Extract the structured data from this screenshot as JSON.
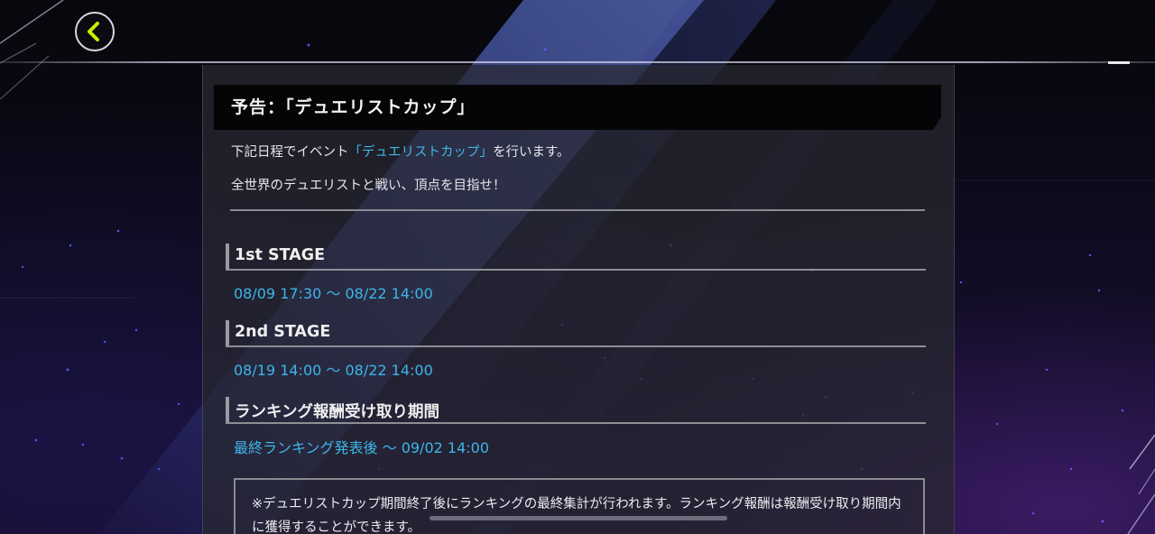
{
  "header": {
    "back_icon": "chevron-left-icon",
    "accent_color": "#c8f000"
  },
  "notice": {
    "title": "予告：「デュエリストカップ」",
    "intro_line1_prefix": "下記日程でイベント",
    "intro_line1_highlight": "「デュエリストカップ」",
    "intro_line1_suffix": "を行います。",
    "intro_line2": "全世界のデュエリストと戦い、頂点を目指せ！",
    "highlight_color": "#3fb8e8"
  },
  "sections": [
    {
      "label": "1st STAGE",
      "value": "08/09 17:30 ～ 08/22 14:00"
    },
    {
      "label": "2nd STAGE",
      "value": "08/19 14:00 ～ 08/22 14:00"
    },
    {
      "label": "ランキング報酬受け取り期間",
      "value": "最終ランキング発表後 ～ 09/02 14:00"
    }
  ],
  "note": {
    "text": "※デュエリストカップ期間終了後にランキングの最終集計が行われます。ランキング報酬は報酬受け取り期間内に獲得することができます。"
  }
}
